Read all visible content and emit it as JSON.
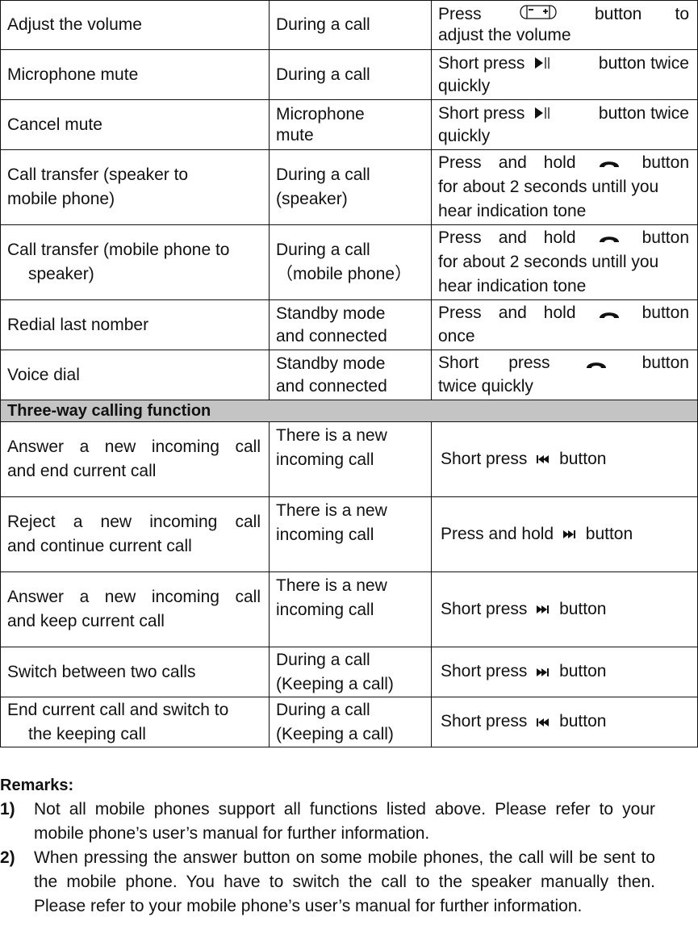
{
  "table": {
    "rows": [
      {
        "function": "Adjust the volume",
        "condition": "During a call",
        "operation": {
          "before": "Press",
          "icon": "volume-rocker-icon",
          "after": "button to adjust the volume"
        }
      },
      {
        "function": "Microphone mute",
        "condition": "During a call",
        "operation": {
          "before": "Short press",
          "icon": "play-pause-icon",
          "after": "button twice quickly"
        }
      },
      {
        "function": "Cancel mute",
        "condition": "Microphone mute",
        "operation": {
          "before": "Short press",
          "icon": "play-pause-icon",
          "after": "button twice quickly"
        }
      },
      {
        "function": "Call transfer (speaker to mobile phone)",
        "condition": "During a call (speaker)",
        "operation": {
          "before": "Press and hold",
          "icon": "phone-handset-icon",
          "after": "button for about 2 seconds untill you hear indication tone"
        }
      },
      {
        "function": "Call transfer (mobile phone to speaker)",
        "condition": "During a call （mobile phone）",
        "operation": {
          "before": "Press and hold",
          "icon": "phone-handset-icon",
          "after": "button for about 2 seconds untill you hear indication tone"
        }
      },
      {
        "function": "Redial last nomber",
        "condition": "Standby mode and connected",
        "operation": {
          "before": "Press and hold",
          "icon": "phone-handset-icon",
          "after": "button once"
        }
      },
      {
        "function": "Voice dial",
        "condition": "Standby mode and connected",
        "operation": {
          "before": "Short press",
          "icon": "phone-handset-icon",
          "after": "button twice quickly"
        }
      }
    ],
    "section_title": "Three-way calling function",
    "three_way_rows": [
      {
        "function": "Answer a new incoming call and end current call",
        "condition": "There is a new incoming call",
        "operation": {
          "before": "Short press",
          "icon": "skip-previous-icon",
          "after": "button"
        }
      },
      {
        "function": "Reject a new incoming call and continue current call",
        "condition": "There is a new incoming call",
        "operation": {
          "before": "Press and hold",
          "icon": "skip-next-icon",
          "after": "button"
        }
      },
      {
        "function": "Answer a new incoming call and keep current call",
        "condition": "There is a new incoming call",
        "operation": {
          "before": "Short press",
          "icon": "skip-next-icon",
          "after": "button"
        }
      },
      {
        "function": "Switch between two calls",
        "condition": "During a call (Keeping a call)",
        "operation": {
          "before": "Short press",
          "icon": "skip-next-icon",
          "after": "button"
        }
      },
      {
        "function": "End current call and switch to the keeping call",
        "condition": "During a call (Keeping a call)",
        "operation": {
          "before": "Short press",
          "icon": "skip-previous-icon",
          "after": "button"
        }
      }
    ]
  },
  "text": {
    "r0_c1": "Adjust the volume",
    "r0_c2": "During a call",
    "r0_c3_a": "Press",
    "r0_c3_b": "button",
    "r0_c3_c": "to",
    "r0_c3_d": "adjust the volume",
    "r1_c1": "Microphone mute",
    "r1_c2": "During a call",
    "r1_c3_a": "Short press",
    "r1_c3_b": "button twice",
    "r1_c3_c": "quickly",
    "r2_c1": "Cancel mute",
    "r2_c2_a": "Microphone",
    "r2_c2_b": "mute",
    "r2_c3_a": "Short press",
    "r2_c3_b": "button twice",
    "r2_c3_c": "quickly",
    "r3_c1_a": "Call transfer (speaker to",
    "r3_c1_b": "mobile phone)",
    "r3_c2_a": "During a call",
    "r3_c2_b": "(speaker)",
    "r3_c3_a": "Press and hold",
    "r3_c3_b": "button",
    "r3_c3_c": "for about 2 seconds untill you",
    "r3_c3_d": "hear indication tone",
    "r4_c1_a": "Call transfer (mobile phone to",
    "r4_c1_b": "speaker)",
    "r4_c2_a": "During a call",
    "r4_c2_b": "（mobile phone）",
    "r4_c3_a": "Press and hold",
    "r4_c3_b": "button",
    "r4_c3_c": "for about 2 seconds untill you",
    "r4_c3_d": "hear indication tone",
    "r5_c1": "Redial last nomber",
    "r5_c2_a": "Standby mode",
    "r5_c2_b": "and connected",
    "r5_c3_a": "Press and hold",
    "r5_c3_b": "button",
    "r5_c3_c": "once",
    "r6_c1": "Voice dial",
    "r6_c2_a": "Standby mode",
    "r6_c2_b": "and connected",
    "r6_c3_a": "Short press",
    "r6_c3_b": "button",
    "r6_c3_c": "twice quickly",
    "section": "Three-way calling function",
    "t0_c1_a": "Answer a new incoming call",
    "t0_c1_b": "and end current call",
    "t0_c2_a": "There is a new",
    "t0_c2_b": "incoming call",
    "t0_c3_a": "Short press",
    "t0_c3_b": "button",
    "t1_c1_a": "Reject a new incoming call",
    "t1_c1_b": "and continue current call",
    "t1_c2_a": "There is a new",
    "t1_c2_b": "incoming call",
    "t1_c3_a": "Press and hold",
    "t1_c3_b": "button",
    "t2_c1_a": "Answer a new incoming call",
    "t2_c1_b": "and keep current call",
    "t2_c2_a": "There is a new",
    "t2_c2_b": "incoming call",
    "t2_c3_a": "Short press",
    "t2_c3_b": "button",
    "t3_c1": "Switch between two calls",
    "t3_c2_a": "During a call",
    "t3_c2_b": "(Keeping a call)",
    "t3_c3_a": "Short press",
    "t3_c3_b": "button",
    "t4_c1_a": "End current call and switch to",
    "t4_c1_b": "the keeping call",
    "t4_c2_a": "During a call",
    "t4_c2_b": "(Keeping a call)",
    "t4_c3_a": "Short press",
    "t4_c3_b": "button"
  },
  "remarks": {
    "title": "Remarks:",
    "items": [
      {
        "num": "1)",
        "text": "Not all mobile phones support all functions listed above. Please refer to your mobile phone’s user’s manual for further information."
      },
      {
        "num": "2)",
        "text": "When pressing the answer button on some mobile phones, the call will be sent to the mobile phone. You have to switch the call to the speaker manually then. Please refer to your mobile phone’s user’s manual for further information."
      }
    ]
  }
}
